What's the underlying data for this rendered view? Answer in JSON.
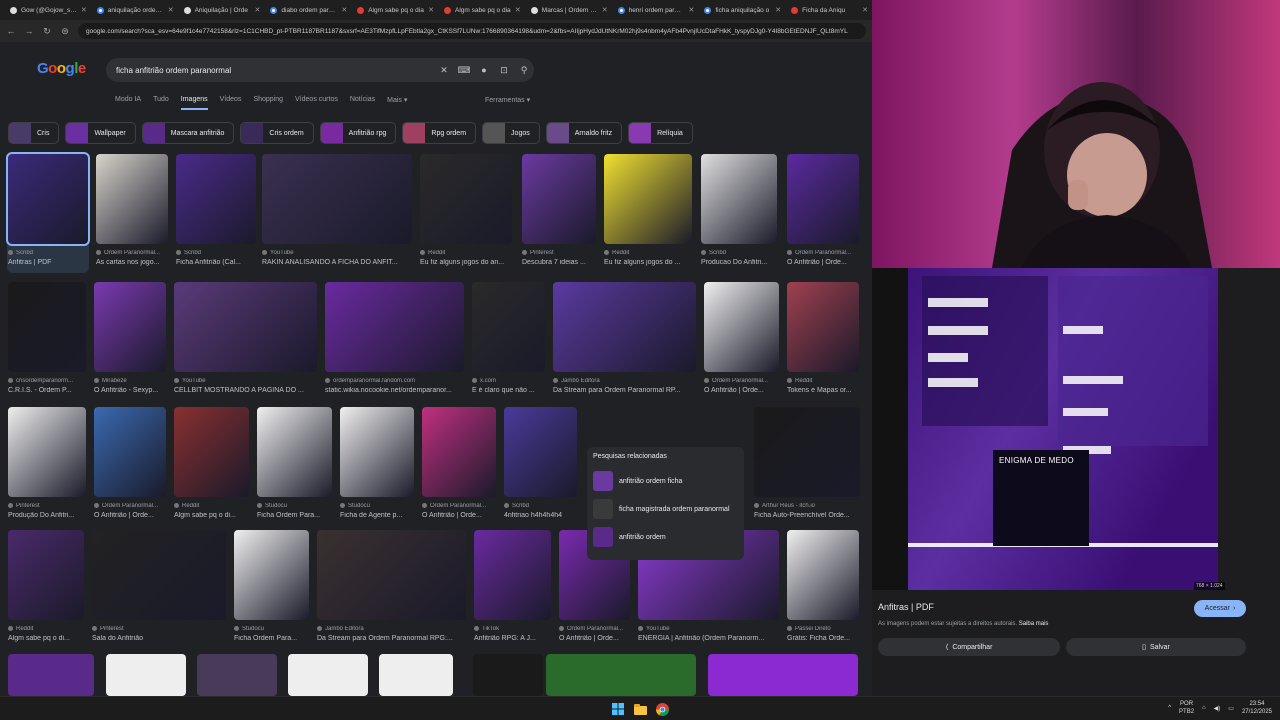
{
  "tabs": [
    {
      "label": "Gow (@Gojow_s) / X",
      "fav": "w"
    },
    {
      "label": "aniquilação ordem p",
      "fav": "g"
    },
    {
      "label": "Aniquilação | Orde",
      "fav": "w"
    },
    {
      "label": "diabo ordem paranor",
      "fav": "g"
    },
    {
      "label": "Algm sabe pq o dia",
      "fav": "r"
    },
    {
      "label": "Algm sabe pq o dia",
      "fav": "r"
    },
    {
      "label": "Marcas | Ordem Pa",
      "fav": "w"
    },
    {
      "label": "henri ordem parano",
      "fav": "g"
    },
    {
      "label": "ficha aniquilação o",
      "fav": "g"
    },
    {
      "label": "Ficha da Aniqu",
      "fav": "r"
    }
  ],
  "address": {
    "url": "google.com/search?sca_esv=64e9f1c4e7742158&rlz=1C1CHBD_pt-PTBR1187BR1187&sxsrf=AE3TifMzpfLLpFEbtla2gx_CtKSSf7LUNw:1766890364198&udm=2&fbs=AIIjpHydJdUtNKrM02hj9s4nbm4yAFb4PvnjIUcDtaFHkK_tyspyDJg0-Y4I8bGEtEDNJF_QLt8mYL"
  },
  "google": {
    "logo_letters": [
      "G",
      "o",
      "o",
      "g",
      "l",
      "e"
    ],
    "query": "ficha anfitrião ordem paranormal",
    "tabs": [
      "Modo IA",
      "Tudo",
      "Imagens",
      "Vídeos",
      "Shopping",
      "Vídeos curtos",
      "Notícias",
      "Mais ▾"
    ],
    "active_tab": "Imagens",
    "tools_label": "Ferramentas ▾",
    "chips": [
      {
        "label": "Cris",
        "color": "#4a3a6a"
      },
      {
        "label": "Wallpaper",
        "color": "#6a2fa0"
      },
      {
        "label": "Mascara anfitrião",
        "color": "#5a2a8a"
      },
      {
        "label": "Cris ordem",
        "color": "#3a2a5a"
      },
      {
        "label": "Anfitrião rpg",
        "color": "#7a2aa0"
      },
      {
        "label": "Rpg ordem",
        "color": "#a04060"
      },
      {
        "label": "Jogos",
        "color": "#555555"
      },
      {
        "label": "Arnaldo fritz",
        "color": "#6a4a8a"
      },
      {
        "label": "Relíquia",
        "color": "#8a3ab0"
      }
    ],
    "results": [
      {
        "src": "Scribd",
        "title": "Anfitras | PDF",
        "color": "#3b2a7a",
        "selected": true
      },
      {
        "src": "Ordem Paranormal...",
        "title": "As cartas nos jogo...",
        "color": "#d8d4cc"
      },
      {
        "src": "Scribd",
        "title": "Ficha Anfitrião (Cal...",
        "color": "#4a2a8a"
      },
      {
        "src": "YouTube",
        "title": "RAKIN ANALISANDO A FICHA DO ANFIT...",
        "color": "#3a3050"
      },
      {
        "src": "Reddit",
        "title": "Eu fiz alguns jogos do an...",
        "color": "#2a2a2a"
      },
      {
        "src": "Pinterest",
        "title": "Descubra 7 ideias ...",
        "color": "#6a3aa0"
      },
      {
        "src": "Reddit",
        "title": "Eu fiz alguns jogos do ...",
        "color": "#f0e030"
      },
      {
        "src": "Scribd",
        "title": "Producao Do Anfitri...",
        "color": "#e0e0e0"
      },
      {
        "src": "Ordem Paranormal...",
        "title": "O Anfitrião | Orde...",
        "color": "#5a2aa0"
      },
      {
        "src": "crisordemparanorm...",
        "title": "C.R.I.S. - Ordem P...",
        "color": "#1a1a1a"
      },
      {
        "src": "Mirabeze",
        "title": "O Anfitrião - Sexyp...",
        "color": "#7a3ab0"
      },
      {
        "src": "YouTube",
        "title": "CELLBIT MOSTRANDO A PÁGINA DO ...",
        "color": "#5a3a7a"
      },
      {
        "src": "ordemparanormal.fandom.com",
        "title": "static.wikia.nocookie.net/ordemparanor...",
        "color": "#6a2aa0"
      },
      {
        "src": "x.com",
        "title": "E é claro que não ...",
        "color": "#2a2a2a"
      },
      {
        "src": "Jambô Editora",
        "title": "Da Stream para Ordem Paranormal RP...",
        "color": "#5a3aa0"
      },
      {
        "src": "Ordem Paranormal...",
        "title": "O Anfitrião | Orde...",
        "color": "#f0f0f0"
      },
      {
        "src": "Reddit",
        "title": "Tokens e Mapas or...",
        "color": "#a04050"
      },
      {
        "src": "Pinterest",
        "title": "Produção Do Anfitri...",
        "color": "#eeeeee"
      },
      {
        "src": "Ordem Paranormal...",
        "title": "O Anfitrião | Orde...",
        "color": "#3a6ab0"
      },
      {
        "src": "Reddit",
        "title": "Algm sabe pq o di...",
        "color": "#8a3030"
      },
      {
        "src": "Studocu",
        "title": "Ficha Ordem Para...",
        "color": "#f0f0f0"
      },
      {
        "src": "Studocu",
        "title": "Ficha de Agente p...",
        "color": "#f0f0f0"
      },
      {
        "src": "Ordem Paranormal...",
        "title": "O Anfitrião | Orde...",
        "color": "#c03080"
      },
      {
        "src": "Scribd",
        "title": "4nfitriao h4h4h4h4",
        "color": "#4a3a9a"
      },
      {
        "src": "Arthur Reus - itch.io",
        "title": "Ficha Auto-Preenchível Orde...",
        "color": "#1a1a1a"
      },
      {
        "src": "Reddit",
        "title": "Algm sabe pq o di...",
        "color": "#4a2a6a"
      },
      {
        "src": "Pinterest",
        "title": "Sala do Anfitrião",
        "color": "#222222"
      },
      {
        "src": "Studocu",
        "title": "Ficha Ordem Para...",
        "color": "#f0f0f0"
      },
      {
        "src": "Jambô Editora",
        "title": "Da Stream para Ordem Paranormal RPG:...",
        "color": "#3a3030"
      },
      {
        "src": "TikTok",
        "title": "Anfitrião RPG: A J...",
        "color": "#6a2aa0"
      },
      {
        "src": "Ordem Paranormal...",
        "title": "O Anfitrião | Orde...",
        "color": "#7a2ab0"
      },
      {
        "src": "YouTube",
        "title": "ENERGIA | Anfitrião (Ordem Paranorm...",
        "color": "#8a3ad0"
      },
      {
        "src": "Passei Direto",
        "title": "Grátis: Ficha Orde...",
        "color": "#f0f0f0"
      }
    ],
    "related": {
      "heading": "Pesquisas relacionadas",
      "items": [
        {
          "label": "anfitrião ordem ficha",
          "color": "#6a3aa0"
        },
        {
          "label": "ficha magistrada ordem paranormal",
          "color": "#3a3a3a"
        },
        {
          "label": "anfitrião ordem",
          "color": "#5a2a8a"
        }
      ]
    }
  },
  "preview": {
    "title": "Anfitras | PDF",
    "notice": "As imagens podem estar sujeitas a direitos autorais.",
    "notice_link": "Saiba mais",
    "visit_label": "Acessar",
    "share_label": "Compartilhar",
    "save_label": "Salvar",
    "image_size": "768 × 1.024",
    "image_heading": "ENIGMA DE MEDO"
  },
  "taskbar": {
    "lang": "POR",
    "kbd": "PTB2",
    "time": "23:54",
    "date": "27/12/2025"
  }
}
